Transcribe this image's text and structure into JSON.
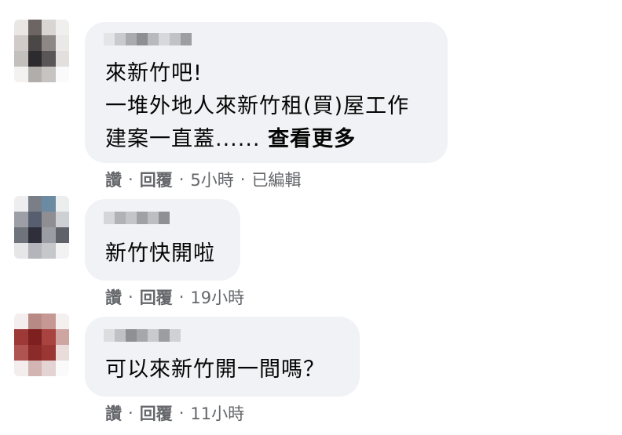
{
  "comments": [
    {
      "lines": [
        "來新竹吧!",
        "一堆外地人來新竹租(買)屋工作",
        "建案一直蓋......"
      ],
      "see_more": "查看更多",
      "like": "讚",
      "reply": "回覆",
      "time": "5小時",
      "edited": "已編輯"
    },
    {
      "lines": [
        "新竹快開啦"
      ],
      "like": "讚",
      "reply": "回覆",
      "time": "19小時"
    },
    {
      "lines": [
        "可以來新竹開一間嗎？"
      ],
      "like": "讚",
      "reply": "回覆",
      "time": "11小時"
    }
  ],
  "separator": "·",
  "colors": {
    "bubble": "#f0f2f5",
    "meta": "#65676b",
    "text": "#050505"
  }
}
